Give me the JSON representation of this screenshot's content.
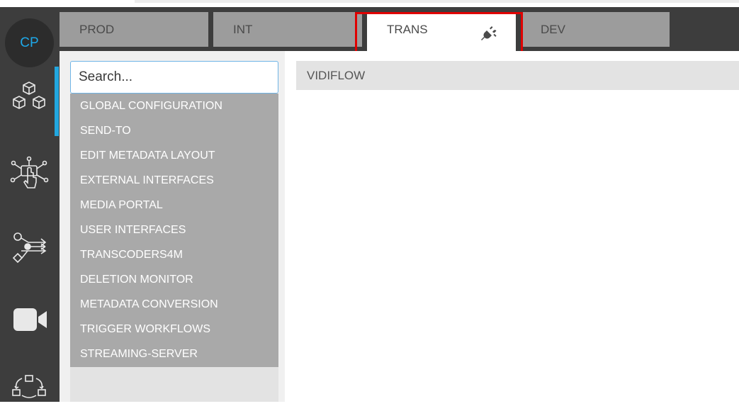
{
  "avatar": {
    "initials": "CP"
  },
  "rail": [
    {
      "icon": "cubes-icon"
    },
    {
      "icon": "network-touch-icon"
    },
    {
      "icon": "workflow-icon"
    },
    {
      "icon": "video-camera-icon"
    },
    {
      "icon": "hierarchy-cycle-icon"
    }
  ],
  "tabs": [
    {
      "label": "PROD"
    },
    {
      "label": "INT"
    },
    {
      "label": "TRANS",
      "icon": "plug-icon"
    },
    {
      "label": "DEV"
    }
  ],
  "search": {
    "placeholder": "Search..."
  },
  "menu": [
    {
      "label": "GLOBAL CONFIGURATION"
    },
    {
      "label": "SEND-TO"
    },
    {
      "label": "EDIT METADATA LAYOUT"
    },
    {
      "label": "EXTERNAL INTERFACES"
    },
    {
      "label": "MEDIA PORTAL"
    },
    {
      "label": "USER INTERFACES"
    },
    {
      "label": "TRANSCODERS4M"
    },
    {
      "label": "DELETION MONITOR"
    },
    {
      "label": "METADATA CONVERSION"
    },
    {
      "label": "TRIGGER WORKFLOWS"
    },
    {
      "label": "STREAMING-SERVER"
    }
  ],
  "content": {
    "header": "VIDIFLOW"
  },
  "colors": {
    "accent": "#22a7e0",
    "highlight": "#e00000",
    "rail": "#3d3d3d"
  }
}
